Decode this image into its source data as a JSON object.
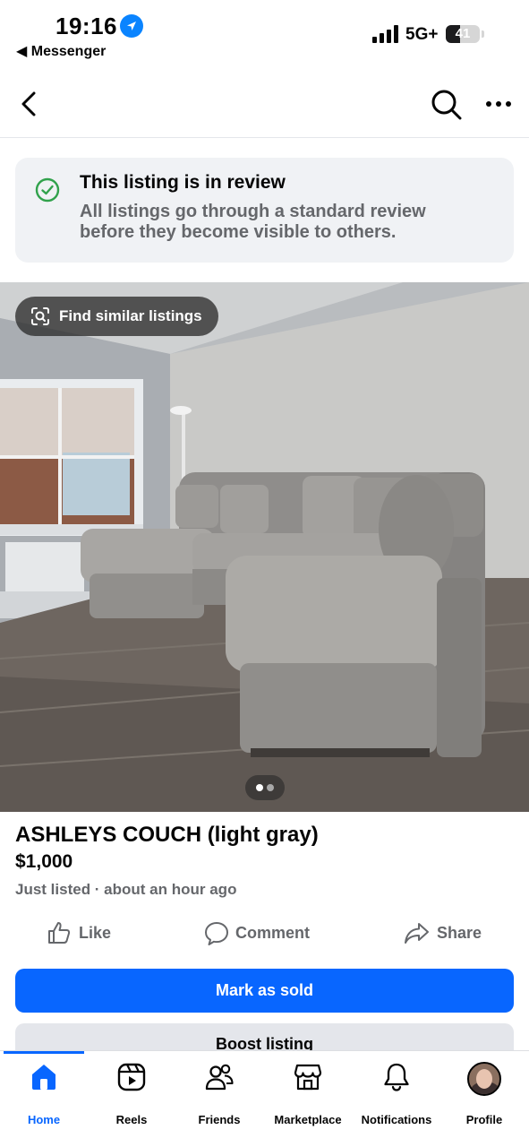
{
  "status_bar": {
    "time": "19:16",
    "back_app": "◀ Messenger",
    "network": "5G+",
    "battery": "41",
    "battery_level": 0.41
  },
  "nav": {
    "back_icon": "chevron-left-icon",
    "search_icon": "search-icon",
    "more_icon": "ellipsis-icon"
  },
  "review_notice": {
    "title": "This listing is in review",
    "description": "All listings go through a standard review before they become visible to others.",
    "icon": "check-circle-icon",
    "icon_color": "#31a24c"
  },
  "photo": {
    "find_similar_label": "Find similar listings",
    "page_count": 2,
    "current_page": 1
  },
  "listing": {
    "title": "ASHLEYS COUCH (light gray)",
    "price": "$1,000",
    "meta": "Just listed · about an hour ago"
  },
  "actions": {
    "like": "Like",
    "comment": "Comment",
    "share": "Share"
  },
  "buttons": {
    "mark_sold": "Mark as sold",
    "boost": "Boost listing"
  },
  "tabbar": {
    "items": [
      {
        "label": "Home",
        "icon": "home-icon",
        "active": true
      },
      {
        "label": "Reels",
        "icon": "reels-icon",
        "active": false
      },
      {
        "label": "Friends",
        "icon": "friends-icon",
        "active": false
      },
      {
        "label": "Marketplace",
        "icon": "marketplace-icon",
        "active": false
      },
      {
        "label": "Notifications",
        "icon": "bell-icon",
        "active": false
      },
      {
        "label": "Profile",
        "icon": "avatar",
        "active": false
      }
    ]
  },
  "colors": {
    "accent": "#0866ff",
    "secondary_text": "#65676b",
    "card_bg": "#f0f2f5"
  }
}
